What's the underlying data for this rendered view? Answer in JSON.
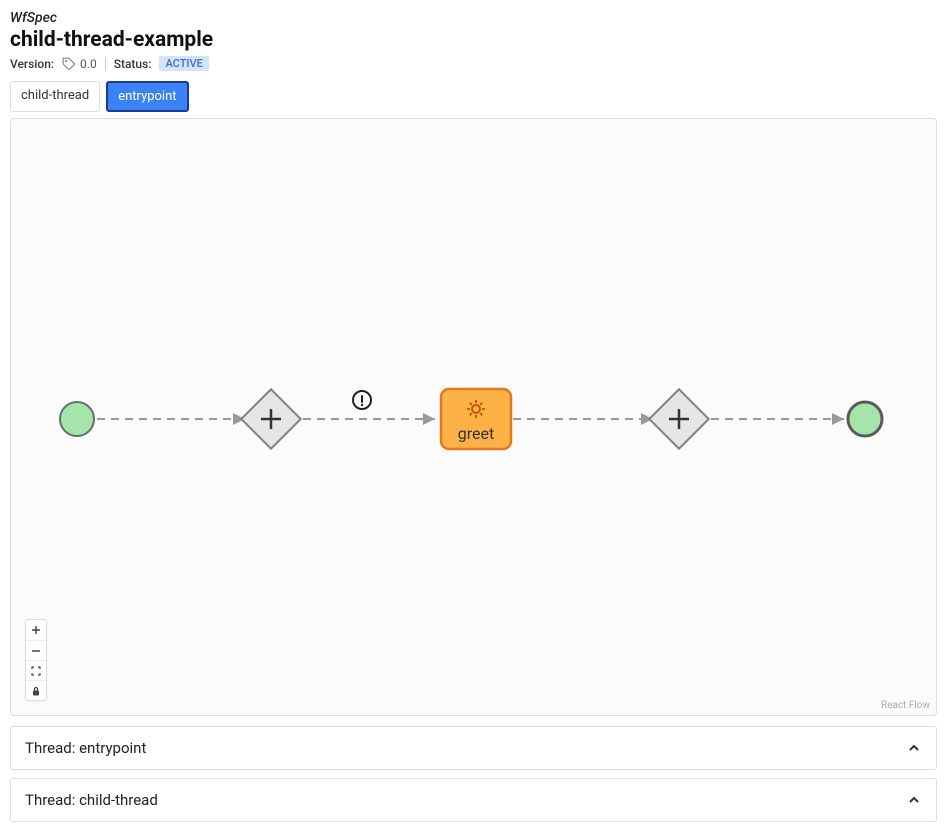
{
  "header": {
    "spec_type": "WfSpec",
    "title": "child-thread-example",
    "version_label": "Version:",
    "version_value": "0.0",
    "status_label": "Status:",
    "status_value": "ACTIVE"
  },
  "tabs": [
    {
      "label": "child-thread"
    },
    {
      "label": "entrypoint"
    }
  ],
  "active_tab_index": 1,
  "flow": {
    "nodes": [
      {
        "id": "start",
        "type": "start-circle"
      },
      {
        "id": "gw1",
        "type": "gateway"
      },
      {
        "id": "task1",
        "type": "task",
        "label": "greet"
      },
      {
        "id": "gw2",
        "type": "gateway"
      },
      {
        "id": "end",
        "type": "end-circle"
      }
    ],
    "edges": [
      {
        "from": "start",
        "to": "gw1"
      },
      {
        "from": "gw1",
        "to": "task1",
        "badge": "exclamation"
      },
      {
        "from": "task1",
        "to": "gw2"
      },
      {
        "from": "gw2",
        "to": "end"
      }
    ]
  },
  "attribution": "React Flow",
  "threads": [
    {
      "label": "Thread: entrypoint"
    },
    {
      "label": "Thread: child-thread"
    }
  ]
}
